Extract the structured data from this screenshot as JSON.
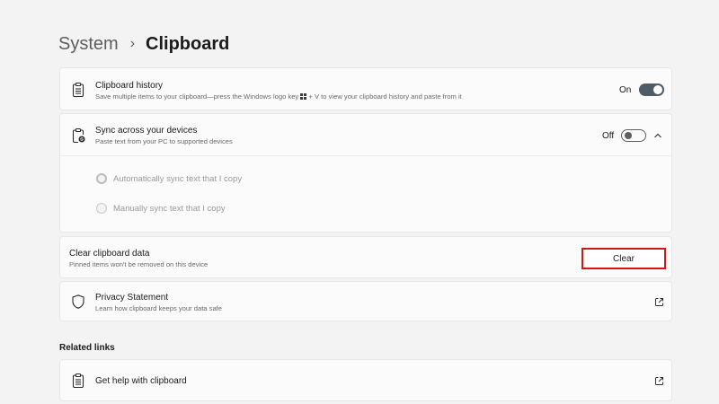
{
  "breadcrumb": {
    "parent": "System",
    "separator": "›",
    "current": "Clipboard"
  },
  "clipboard_history": {
    "title": "Clipboard history",
    "subtitle_before": "Save multiple items to your clipboard—press the Windows logo key ",
    "subtitle_after": " + V to view your clipboard history and paste from it",
    "state_label": "On",
    "enabled": true
  },
  "sync": {
    "title": "Sync across your devices",
    "subtitle": "Paste text from your PC to supported devices",
    "state_label": "Off",
    "enabled": false,
    "expanded": true,
    "options": [
      {
        "label": "Automatically sync text that I copy",
        "selected": true,
        "disabled": true
      },
      {
        "label": "Manually sync text that I copy",
        "selected": false,
        "disabled": true
      }
    ]
  },
  "clear_data": {
    "title": "Clear clipboard data",
    "subtitle": "Pinned items won't be removed on this device",
    "button_label": "Clear",
    "highlight_color": "#d11616"
  },
  "privacy": {
    "title": "Privacy Statement",
    "subtitle": "Learn how clipboard keeps your data safe"
  },
  "related_links": {
    "heading": "Related links",
    "items": [
      {
        "label": "Get help with clipboard"
      }
    ]
  },
  "colors": {
    "toggle_on": "#4d5c68",
    "page_background": "#f3f3f3",
    "card_background": "#fbfbfb"
  }
}
